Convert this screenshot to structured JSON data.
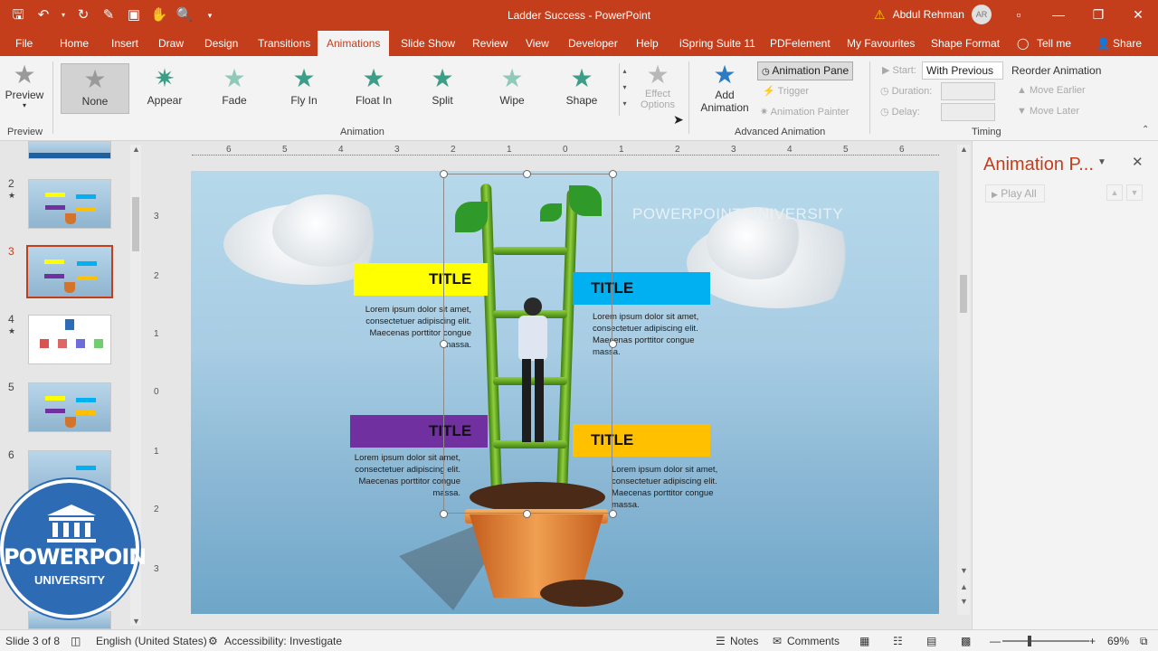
{
  "window": {
    "doc_title": "Ladder Success - PowerPoint",
    "user_name": "Abdul Rehman",
    "user_initials": "AR"
  },
  "tabs": [
    "File",
    "Home",
    "Insert",
    "Draw",
    "Design",
    "Transitions",
    "Animations",
    "Slide Show",
    "Review",
    "View",
    "Developer",
    "Help",
    "iSpring Suite 11",
    "PDFelement",
    "My Favourites",
    "Shape Format",
    "Tell me",
    "Share"
  ],
  "active_tab": "Animations",
  "ribbon": {
    "preview_label": "Preview",
    "preview_group": "Preview",
    "animation_group": "Animation",
    "gallery": [
      "None",
      "Appear",
      "Fade",
      "Fly In",
      "Float In",
      "Split",
      "Wipe",
      "Shape"
    ],
    "selected_animation": "None",
    "effect_options": "Effect\nOptions",
    "effect_options_1": "Effect",
    "effect_options_2": "Options",
    "add_animation_1": "Add",
    "add_animation_2": "Animation",
    "animation_pane": "Animation Pane",
    "trigger": "Trigger",
    "animation_painter": "Animation Painter",
    "advanced_group": "Advanced Animation",
    "start_label": "Start:",
    "start_value": "With Previous",
    "duration_label": "Duration:",
    "delay_label": "Delay:",
    "reorder_label": "Reorder Animation",
    "move_earlier": "Move Earlier",
    "move_later": "Move Later",
    "timing_group": "Timing"
  },
  "thumbnails": [
    {
      "num": "2",
      "star": "★"
    },
    {
      "num": "3",
      "star": ""
    },
    {
      "num": "4",
      "star": "★"
    },
    {
      "num": "5",
      "star": ""
    },
    {
      "num": "6",
      "star": ""
    }
  ],
  "badge": {
    "line1": "POWERPOINT",
    "line2": "UNIVERSITY"
  },
  "ruler": {
    "h": [
      "6",
      "5",
      "4",
      "3",
      "2",
      "1",
      "0",
      "1",
      "2",
      "3",
      "4",
      "5",
      "6"
    ],
    "v": [
      "3",
      "2",
      "1",
      "0",
      "1",
      "2",
      "3"
    ]
  },
  "slide": {
    "watermark": "POWERPOINT UNIVERSITY",
    "items": [
      {
        "title": "TITLE",
        "color": "#ffff00",
        "text": "Lorem ipsum dolor sit amet, consectetuer adipiscing elit. Maecenas porttitor congue massa."
      },
      {
        "title": "TITLE",
        "color": "#00b0f0",
        "text": "Lorem ipsum dolor sit amet, consectetuer adipiscing elit. Maecenas porttitor congue massa."
      },
      {
        "title": "TITLE",
        "color": "#7030a0",
        "text": "Lorem ipsum dolor sit amet, consectetuer adipiscing elit. Maecenas porttitor congue massa."
      },
      {
        "title": "TITLE",
        "color": "#ffc000",
        "text": "Lorem ipsum dolor sit amet, consectetuer adipiscing elit. Maecenas porttitor congue massa."
      }
    ]
  },
  "anim_pane": {
    "title": "Animation P...",
    "play_all": "Play All"
  },
  "status": {
    "slide": "Slide 3 of 8",
    "language": "English (United States)",
    "accessibility": "Accessibility: Investigate",
    "notes": "Notes",
    "comments": "Comments",
    "zoom": "69%"
  },
  "colors": {
    "accent": "#c43e1c"
  }
}
